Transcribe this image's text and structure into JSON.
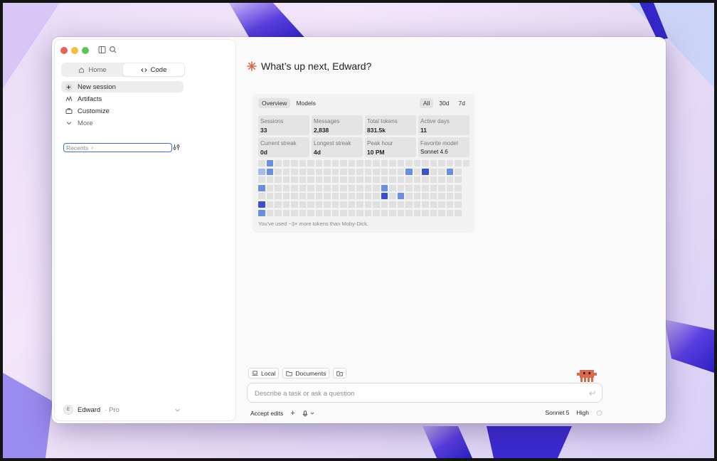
{
  "sidebar": {
    "tabs": [
      {
        "label": "Home",
        "icon": "home-icon"
      },
      {
        "label": "Code",
        "icon": "code-icon"
      }
    ],
    "nav": [
      {
        "label": "New session",
        "icon": "plus-icon"
      },
      {
        "label": "Artifacts",
        "icon": "artifacts-icon"
      },
      {
        "label": "Customize",
        "icon": "briefcase-icon"
      },
      {
        "label": "More",
        "icon": "chevron-down-icon"
      }
    ],
    "recents_label": "Recents",
    "user": {
      "initial": "E",
      "name": "Edward",
      "plan": "· Pro"
    }
  },
  "main": {
    "greeting": "What’s up next, Edward?",
    "stats": {
      "tabs": [
        "Overview",
        "Models"
      ],
      "ranges": [
        "All",
        "30d",
        "7d"
      ],
      "items": [
        {
          "label": "Sessions",
          "value": "33"
        },
        {
          "label": "Messages",
          "value": "2,838"
        },
        {
          "label": "Total tokens",
          "value": "831.5k"
        },
        {
          "label": "Active days",
          "value": "11"
        },
        {
          "label": "Current streak",
          "value": "0d"
        },
        {
          "label": "Longest streak",
          "value": "4d"
        },
        {
          "label": "Peak hour",
          "value": "10 PM"
        },
        {
          "label": "Favorite model",
          "value": "Sonnet 4.6"
        }
      ],
      "note": "You've used ~3× more tokens than Moby-Dick."
    },
    "chips": [
      {
        "label": "Local",
        "icon": "laptop-icon"
      },
      {
        "label": "Documents",
        "icon": "folder-icon"
      }
    ],
    "composer": {
      "placeholder": "Describe a task or ask a question"
    },
    "bottom": {
      "mode": "Accept edits",
      "model": "Sonnet 5",
      "effort": "High"
    }
  },
  "colors": {
    "accent": "#d9694a",
    "heat_light": "#a6baec",
    "heat_mid": "#6b8fe0",
    "heat_dark": "#3b4fcf",
    "focus": "#3a70e0"
  }
}
